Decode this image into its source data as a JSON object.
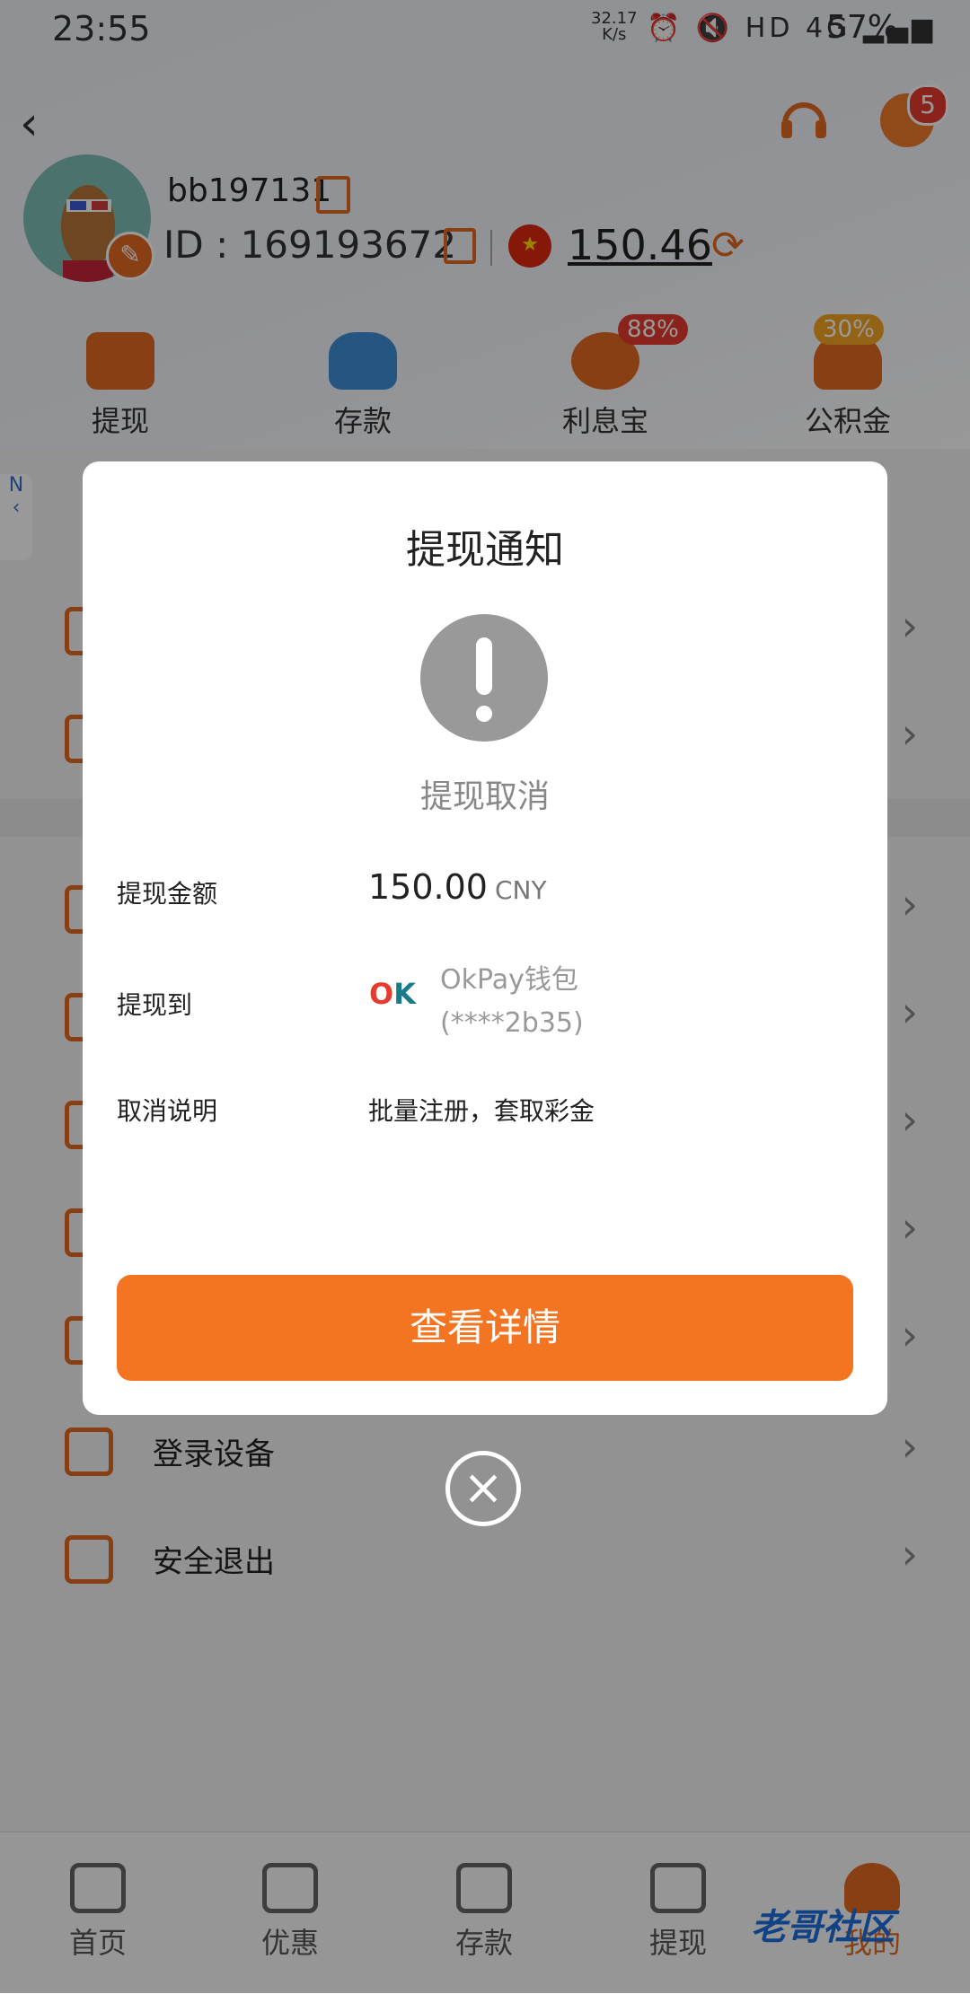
{
  "status_bar": {
    "time": "23:55",
    "net_speed_value": "32.17",
    "net_speed_unit": "K/s",
    "network_labels": "HD 4G",
    "battery": "57%"
  },
  "header": {
    "back_glyph": "‹",
    "message_badge": "5"
  },
  "profile": {
    "username": "bb197131",
    "id_text": "ID : 169193672",
    "balance": "150.46"
  },
  "quick_actions": [
    {
      "label": "提现",
      "badge": ""
    },
    {
      "label": "存款",
      "badge": ""
    },
    {
      "label": "利息宝",
      "badge": "88%"
    },
    {
      "label": "公积金",
      "badge": "30%"
    }
  ],
  "side_button": {
    "label": "N"
  },
  "menu_rows": [
    {
      "label": "登录设备"
    },
    {
      "label": "安全退出"
    }
  ],
  "tabbar": [
    {
      "label": "首页"
    },
    {
      "label": "优惠"
    },
    {
      "label": "存款"
    },
    {
      "label": "提现"
    },
    {
      "label": "我的"
    }
  ],
  "watermark": "老哥社区",
  "dialog": {
    "title": "提现通知",
    "status": "提现取消",
    "amount_label": "提现金额",
    "amount_value": "150.00",
    "amount_currency": "CNY",
    "destination_label": "提现到",
    "destination_name": "OkPay钱包",
    "destination_account": "(****2b35)",
    "cancel_reason_label": "取消说明",
    "cancel_reason": "批量注册，套取彩金",
    "button_label": "查看详情"
  },
  "colors": {
    "accent": "#f37421",
    "badge_red": "#e63b2e",
    "overlay": "rgba(0,0,0,0.4)"
  },
  "icons": {
    "back": "chevron-left-icon",
    "support": "headset-icon",
    "message": "chat-icon",
    "warning": "exclamation-circle-icon",
    "close": "close-circle-icon"
  }
}
